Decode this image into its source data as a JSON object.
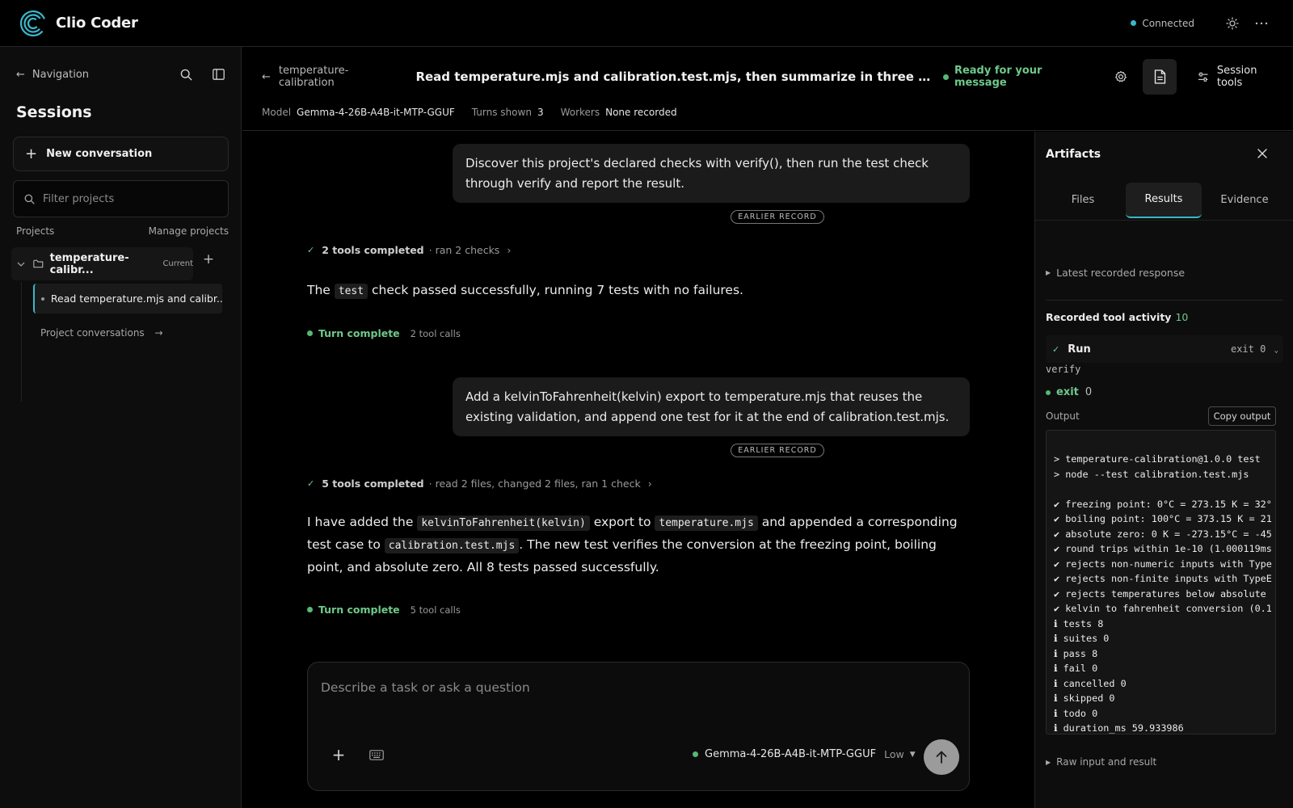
{
  "app": {
    "title": "Clio Coder",
    "connection_status": "Connected",
    "accent_color": "#39b8cc",
    "success_color": "#57b875"
  },
  "sidebar": {
    "nav_label": "Navigation",
    "sessions_title": "Sessions",
    "new_conversation_label": "New conversation",
    "filter_placeholder": "Filter projects",
    "projects_label": "Projects",
    "manage_projects_label": "Manage projects",
    "project": {
      "name": "temperature-calibr...",
      "badge": "Current"
    },
    "session_item": "Read temperature.mjs and calibr...",
    "project_conversations_label": "Project conversations",
    "project_conversations_arrow": "→"
  },
  "header": {
    "breadcrumb": "temperature-calibration",
    "session_title": "Read temperature.mjs and calibration.test.mjs, then summarize in three short bullets w...",
    "status": "Ready for your message",
    "session_tools_label": "Session tools",
    "meta": {
      "model_label": "Model",
      "model_value": "Gemma-4-26B-A4B-it-MTP-GGUF",
      "turns_label": "Turns shown",
      "turns_value": "3",
      "workers_label": "Workers",
      "workers_value": "None recorded"
    }
  },
  "conversation": {
    "earlier_record_label": "EARLIER RECORD",
    "turn1": {
      "user": "Discover this project's declared checks with verify(), then run the test check through verify and report the result.",
      "tools_count": "2 tools completed",
      "tools_detail": "· ran 2 checks",
      "answer": {
        "p1": "The ",
        "code1": "test",
        "p2": " check passed successfully, running 7 tests with no failures."
      },
      "turn_status": "Turn complete",
      "tool_calls": "2 tool calls"
    },
    "turn2": {
      "user": "Add a kelvinToFahrenheit(kelvin) export to temperature.mjs that reuses the existing validation, and append one test for it at the end of calibration.test.mjs.",
      "tools_count": "5 tools completed",
      "tools_detail": "· read 2 files, changed 2 files, ran 1 check",
      "answer": {
        "p1": "I have added the ",
        "code1": "kelvinToFahrenheit(kelvin)",
        "p2": " export to ",
        "code2": "temperature.mjs",
        "p3": " and appended a corresponding test case to ",
        "code3": "calibration.test.mjs",
        "p4": ". The new test verifies the conversion at the freezing point, boiling point, and absolute zero. All 8 tests passed successfully."
      },
      "turn_status": "Turn complete",
      "tool_calls": "5 tool calls"
    }
  },
  "composer": {
    "placeholder": "Describe a task or ask a question",
    "model": "Gemma-4-26B-A4B-it-MTP-GGUF",
    "effort": "Low"
  },
  "artifacts": {
    "title": "Artifacts",
    "tabs": [
      "Files",
      "Results",
      "Evidence"
    ],
    "active_tab": "Results",
    "latest_response_label": "Latest recorded response",
    "recorded_activity_label": "Recorded tool activity",
    "recorded_activity_count": "10",
    "run": {
      "label": "Run",
      "exit_badge": "exit 0",
      "command": "verify",
      "exit_label": "exit",
      "exit_value": "0"
    },
    "output_label": "Output",
    "copy_output_label": "Copy output",
    "output_lines": [
      "> temperature-calibration@1.0.0 test",
      "> node --test calibration.test.mjs",
      "",
      "✔ freezing point: 0°C = 273.15 K = 32°",
      "✔ boiling point: 100°C = 373.15 K = 21",
      "✔ absolute zero: 0 K = -273.15°C = -45",
      "✔ round trips within 1e-10 (1.000119ms",
      "✔ rejects non-numeric inputs with Type",
      "✔ rejects non-finite inputs with TypeE",
      "✔ rejects temperatures below absolute ",
      "✔ kelvin to fahrenheit conversion (0.1",
      "ℹ tests 8",
      "ℹ suites 0",
      "ℹ pass 8",
      "ℹ fail 0",
      "ℹ cancelled 0",
      "ℹ skipped 0",
      "ℹ todo 0",
      "ℹ duration_ms 59.933986"
    ],
    "raw_io_label": "Raw input and result"
  }
}
